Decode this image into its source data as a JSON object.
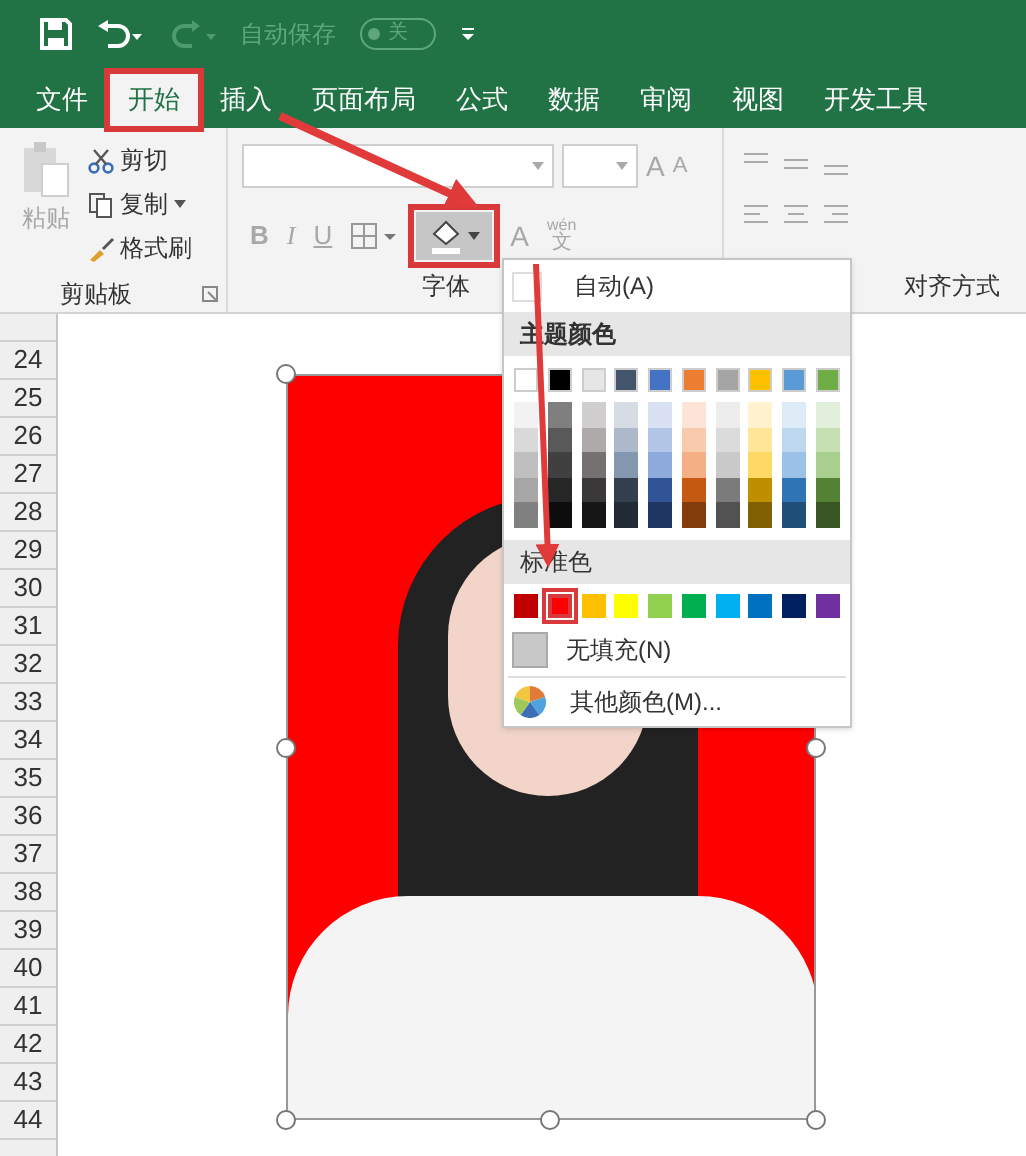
{
  "quick_access": {
    "autosave_label": "自动保存",
    "autosave_toggle": {
      "on": false,
      "label": "关"
    }
  },
  "tabs": [
    {
      "label": "文件",
      "selected": false
    },
    {
      "label": "开始",
      "selected": true
    },
    {
      "label": "插入",
      "selected": false
    },
    {
      "label": "页面布局",
      "selected": false
    },
    {
      "label": "公式",
      "selected": false
    },
    {
      "label": "数据",
      "selected": false
    },
    {
      "label": "审阅",
      "selected": false
    },
    {
      "label": "视图",
      "selected": false
    },
    {
      "label": "开发工具",
      "selected": false
    }
  ],
  "ribbon": {
    "clipboard": {
      "paste": "粘贴",
      "cut": "剪切",
      "copy": "复制",
      "format_painter": "格式刷",
      "group_label": "剪贴板"
    },
    "font": {
      "bold": "B",
      "italic": "I",
      "underline": "U",
      "font_color": "A",
      "grow": "A",
      "shrink": "A",
      "phonetic_top": "wén",
      "phonetic_bottom": "文",
      "group_label": "字体"
    },
    "alignment": {
      "group_label": "对齐方式"
    }
  },
  "row_headers": [
    "24",
    "25",
    "26",
    "27",
    "28",
    "29",
    "30",
    "31",
    "32",
    "33",
    "34",
    "35",
    "36",
    "37",
    "38",
    "39",
    "40",
    "41",
    "42",
    "43",
    "44"
  ],
  "fill_menu": {
    "automatic": "自动(A)",
    "theme_header": "主题颜色",
    "theme_colors": [
      {
        "color": "#ffffff",
        "shades": [
          {
            "color": "#f2f2f2"
          },
          {
            "color": "#d9d9d9"
          },
          {
            "color": "#bfbfbf"
          },
          {
            "color": "#a6a6a6"
          },
          {
            "color": "#808080"
          }
        ]
      },
      {
        "color": "#000000",
        "shades": [
          {
            "color": "#7f7f7f"
          },
          {
            "color": "#595959"
          },
          {
            "color": "#404040"
          },
          {
            "color": "#262626"
          },
          {
            "color": "#0d0d0d"
          }
        ]
      },
      {
        "color": "#e7e6e6",
        "shades": [
          {
            "color": "#d0cece"
          },
          {
            "color": "#aeaaaa"
          },
          {
            "color": "#757171"
          },
          {
            "color": "#3a3838"
          },
          {
            "color": "#171616"
          }
        ]
      },
      {
        "color": "#44546a",
        "shades": [
          {
            "color": "#d6dce4"
          },
          {
            "color": "#adb9ca"
          },
          {
            "color": "#8497b0"
          },
          {
            "color": "#333f4f"
          },
          {
            "color": "#222b35"
          }
        ]
      },
      {
        "color": "#4472c4",
        "shades": [
          {
            "color": "#d9e1f2"
          },
          {
            "color": "#b4c6e7"
          },
          {
            "color": "#8ea9db"
          },
          {
            "color": "#305496"
          },
          {
            "color": "#203764"
          }
        ]
      },
      {
        "color": "#ed7d31",
        "shades": [
          {
            "color": "#fce4d6"
          },
          {
            "color": "#f8cbad"
          },
          {
            "color": "#f4b084"
          },
          {
            "color": "#c65911"
          },
          {
            "color": "#833c0c"
          }
        ]
      },
      {
        "color": "#a5a5a5",
        "shades": [
          {
            "color": "#ededed"
          },
          {
            "color": "#dbdbdb"
          },
          {
            "color": "#c9c9c9"
          },
          {
            "color": "#7b7b7b"
          },
          {
            "color": "#525252"
          }
        ]
      },
      {
        "color": "#ffc000",
        "shades": [
          {
            "color": "#fff2cc"
          },
          {
            "color": "#ffe699"
          },
          {
            "color": "#ffd966"
          },
          {
            "color": "#bf8f00"
          },
          {
            "color": "#806000"
          }
        ]
      },
      {
        "color": "#5b9bd5",
        "shades": [
          {
            "color": "#ddebf7"
          },
          {
            "color": "#bdd7ee"
          },
          {
            "color": "#9bc2e6"
          },
          {
            "color": "#2f75b5"
          },
          {
            "color": "#1f4e78"
          }
        ]
      },
      {
        "color": "#70ad47",
        "shades": [
          {
            "color": "#e2efda"
          },
          {
            "color": "#c6e0b4"
          },
          {
            "color": "#a9d08e"
          },
          {
            "color": "#548235"
          },
          {
            "color": "#375623"
          }
        ]
      }
    ],
    "standard_header": "标准色",
    "standard_colors": [
      {
        "color": "#c00000",
        "selected": false
      },
      {
        "color": "#ff0000",
        "selected": true
      },
      {
        "color": "#ffc000",
        "selected": false
      },
      {
        "color": "#ffff00",
        "selected": false
      },
      {
        "color": "#92d050",
        "selected": false
      },
      {
        "color": "#00b050",
        "selected": false
      },
      {
        "color": "#00b0f0",
        "selected": false
      },
      {
        "color": "#0070c0",
        "selected": false
      },
      {
        "color": "#002060",
        "selected": false
      },
      {
        "color": "#7030a0",
        "selected": false
      }
    ],
    "no_fill": "无填充(N)",
    "more_colors": "其他颜色(M)..."
  }
}
